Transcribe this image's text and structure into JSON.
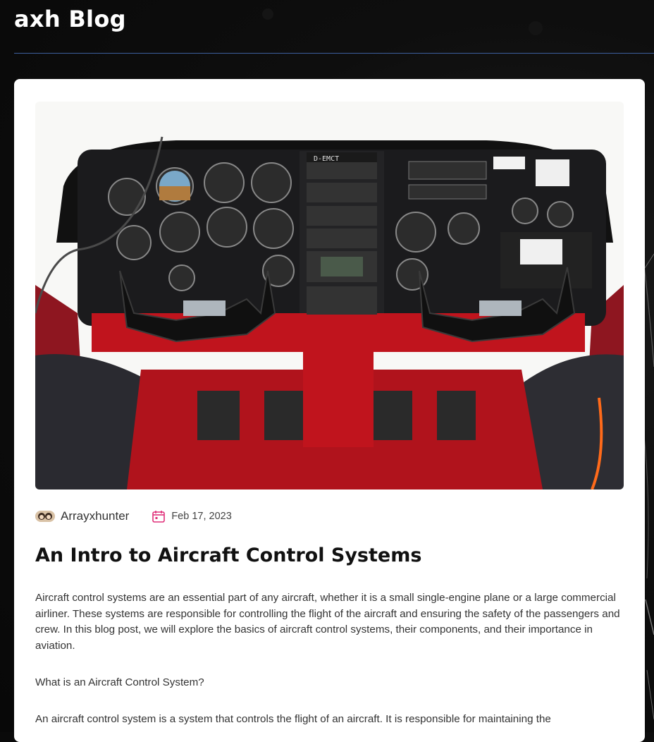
{
  "site": {
    "title": "axh Blog"
  },
  "post": {
    "image_alt": "Aircraft cockpit instrument panel",
    "author": "Arrayxhunter",
    "date": "Feb 17, 2023",
    "title": "An Intro to Aircraft Control Systems",
    "paragraphs": [
      "Aircraft control systems are an essential part of any aircraft, whether it is a small single-engine plane or a large commercial airliner. These systems are responsible for controlling the flight of the aircraft and ensuring the safety of the passengers and crew. In this blog post, we will explore the basics of aircraft control systems, their components, and their importance in aviation.",
      "What is an Aircraft Control System?",
      "An aircraft control system is a system that controls the flight of an aircraft. It is responsible for maintaining the"
    ],
    "panel_registration": "D-EMCT"
  },
  "icons": {
    "date": "calendar-icon",
    "author": "author-avatar"
  },
  "colors": {
    "accent": "#e0307a",
    "rule": "#3d5f9e",
    "panel_red": "#b3161d"
  }
}
